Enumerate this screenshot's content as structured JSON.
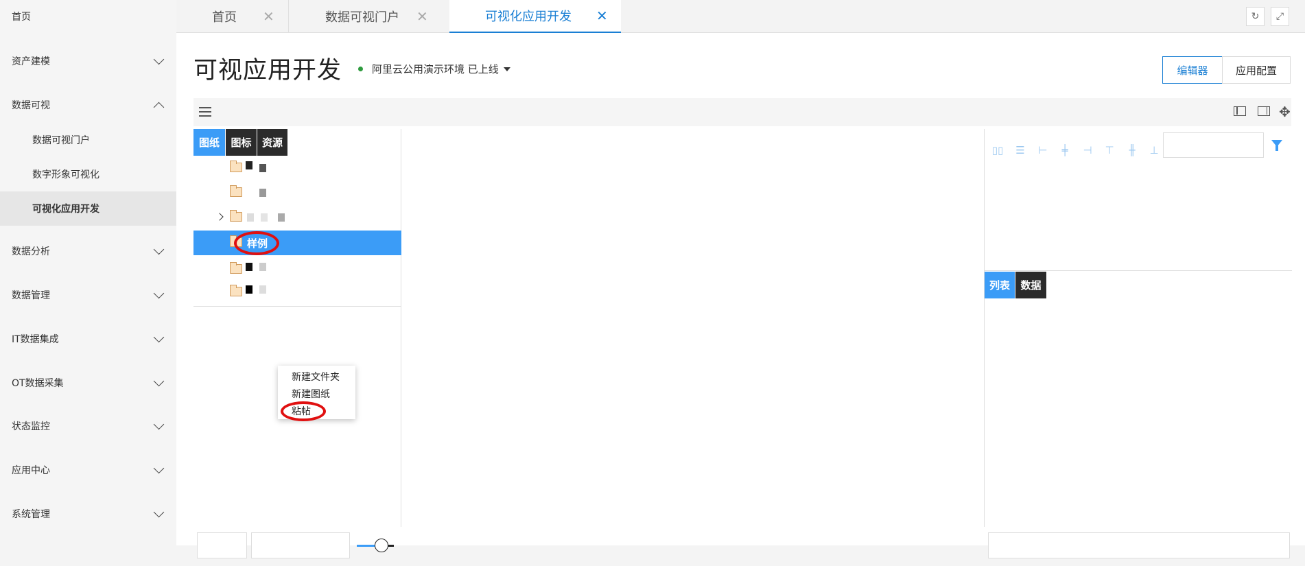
{
  "sidebar": {
    "items": [
      {
        "label": "首页"
      },
      {
        "label": "资产建模"
      },
      {
        "label": "数据可视"
      },
      {
        "label": "数据分析"
      },
      {
        "label": "数据管理"
      },
      {
        "label": "IT数据集成"
      },
      {
        "label": "OT数据采集"
      },
      {
        "label": "状态监控"
      },
      {
        "label": "应用中心"
      },
      {
        "label": "系统管理"
      }
    ],
    "sub_items": [
      {
        "label": "数据可视门户"
      },
      {
        "label": "数字形象可视化"
      },
      {
        "label": "可视化应用开发"
      }
    ]
  },
  "tabs": [
    {
      "label": "首页",
      "close": "✕"
    },
    {
      "label": "数据可视门户",
      "close": "✕"
    },
    {
      "label": "可视化应用开发",
      "close": "✕"
    }
  ],
  "header": {
    "title": "可视应用开发",
    "environment": "阿里云公用演示环境 已上线",
    "editor_button": "编辑器",
    "config_button": "应用配置"
  },
  "left_panel": {
    "tabs": [
      "图纸",
      "图标",
      "资源"
    ],
    "selected_folder": "样例",
    "context_menu": [
      "新建文件夹",
      "新建图纸",
      "粘帖"
    ]
  },
  "right_panel": {
    "tabs": [
      "列表",
      "数据"
    ]
  },
  "colors": {
    "accent": "#1a7fd4",
    "selection": "#3b9cf7",
    "dark_tab": "#2b2b2b",
    "annotation": "#e01010"
  },
  "icons": {
    "refresh": "↻",
    "fullscreen": "⤢",
    "move": "✥"
  }
}
